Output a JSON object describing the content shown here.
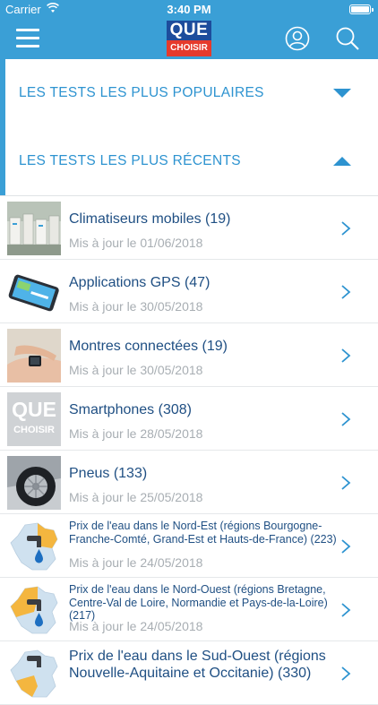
{
  "status_bar": {
    "carrier": "Carrier",
    "time": "3:40 PM"
  },
  "header": {
    "logo_top": "QUE",
    "logo_bottom": "CHOISIR"
  },
  "sections": [
    {
      "title": "LES TESTS LES PLUS POPULAIRES",
      "expanded": false
    },
    {
      "title": "LES TESTS LES PLUS RÉCENTS",
      "expanded": true
    }
  ],
  "items": [
    {
      "name": "Climatiseurs mobiles (19)",
      "date": "Mis à jour le 01/06/2018",
      "thumb": "air-conditioners"
    },
    {
      "name": "Applications GPS (47)",
      "date": "Mis à jour le 30/05/2018",
      "thumb": "gps-device"
    },
    {
      "name": "Montres connectées (19)",
      "date": "Mis à jour le 30/05/2018",
      "thumb": "smartwatch"
    },
    {
      "name": "Smartphones (308)",
      "date": "Mis à jour le 28/05/2018",
      "thumb": "que-choisir-logo",
      "thumb_top": "QUE",
      "thumb_bottom": "CHOISIR"
    },
    {
      "name": "Pneus (133)",
      "date": "Mis à jour le 25/05/2018",
      "thumb": "tyre"
    },
    {
      "name": "Prix de l'eau dans le Nord-Est (régions Bourgogne-Franche-Comté, Grand-Est et Hauts-de-France) (223)",
      "date": "Mis à jour le 24/05/2018",
      "thumb": "water-map"
    },
    {
      "name": "Prix de l'eau dans le Nord-Ouest (régions Bretagne, Centre-Val de Loire, Normandie et Pays-de-la-Loire) (217)",
      "date": "Mis à jour le 24/05/2018",
      "thumb": "water-map"
    },
    {
      "name": "Prix de l'eau dans le Sud-Ouest (régions Nouvelle-Aquitaine et Occitanie) (330)",
      "date": "",
      "thumb": "water-map"
    }
  ],
  "colors": {
    "brand": "#3a9fd6",
    "title_text": "#1f4f83",
    "date_text": "#a8aeb3",
    "section_text": "#2d93d0"
  }
}
